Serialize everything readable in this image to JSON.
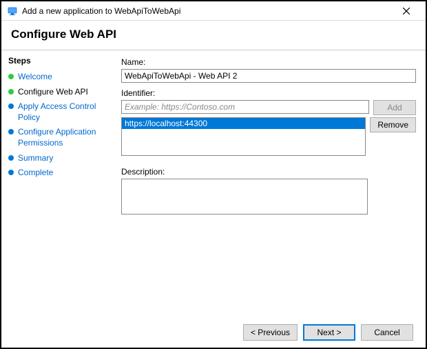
{
  "window": {
    "title": "Add a new application to WebApiToWebApi"
  },
  "heading": "Configure Web API",
  "sidebar": {
    "title": "Steps",
    "items": [
      {
        "label": "Welcome",
        "state": "done"
      },
      {
        "label": "Configure Web API",
        "state": "current"
      },
      {
        "label": "Apply Access Control Policy",
        "state": "pending"
      },
      {
        "label": "Configure Application Permissions",
        "state": "pending"
      },
      {
        "label": "Summary",
        "state": "pending"
      },
      {
        "label": "Complete",
        "state": "pending"
      }
    ]
  },
  "form": {
    "name_label": "Name:",
    "name_value": "WebApiToWebApi - Web API 2",
    "identifier_label": "Identifier:",
    "identifier_placeholder": "Example: https://Contoso.com",
    "identifier_value": "",
    "identifiers": [
      "https://localhost:44300"
    ],
    "add_label": "Add",
    "remove_label": "Remove",
    "description_label": "Description:",
    "description_value": ""
  },
  "footer": {
    "previous": "< Previous",
    "next": "Next >",
    "cancel": "Cancel"
  }
}
